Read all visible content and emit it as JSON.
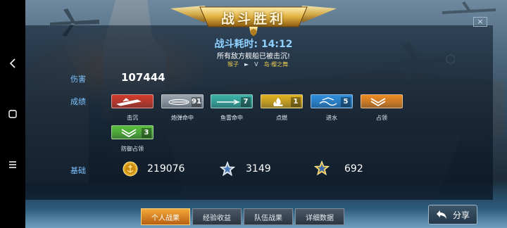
{
  "header": {
    "title": "战斗胜利"
  },
  "battle": {
    "time_label": "战斗耗时: 14:12",
    "result_text": "所有敌方舰船已被击沉!",
    "player_a": "猴子",
    "vs_arrow": "►",
    "vs_text": "V",
    "player_b": "岛·樱之舞"
  },
  "stats": {
    "damage_label": "伤害",
    "damage_value": "107444",
    "achievements_label": "成绩",
    "base_label": "基础"
  },
  "medals": [
    {
      "label": "击沉",
      "count": "",
      "color": "#d23a2a",
      "icon": "ship-sunk-icon"
    },
    {
      "label": "炮弹命中",
      "count": "91",
      "color": "#9aa4ae",
      "icon": "shell-hit-icon"
    },
    {
      "label": "鱼雷命中",
      "count": "7",
      "color": "#3bb3a6",
      "icon": "torpedo-hit-icon"
    },
    {
      "label": "点燃",
      "count": "1",
      "color": "#e2b21e",
      "icon": "fire-icon"
    },
    {
      "label": "进水",
      "count": "5",
      "color": "#2d8fe0",
      "icon": "flooding-icon"
    },
    {
      "label": "占领",
      "count": "",
      "color": "#ee8b22",
      "icon": "capture-icon"
    },
    {
      "label": "防御占领",
      "count": "3",
      "color": "#58c03c",
      "icon": "defend-capture-icon"
    }
  ],
  "rewards": {
    "silver": "219076",
    "experience": "3149",
    "free_experience": "692"
  },
  "tabs": [
    {
      "label": "个人战果",
      "active": true
    },
    {
      "label": "经验收益",
      "active": false
    },
    {
      "label": "队伍战果",
      "active": false
    },
    {
      "label": "详细数据",
      "active": false
    }
  ],
  "share": {
    "label": "分享"
  },
  "close": {
    "label": "×"
  },
  "colors": {
    "accent_blue": "#7fc4ff",
    "gold": "#e8c84a",
    "active_tab": "#f2a93a"
  }
}
